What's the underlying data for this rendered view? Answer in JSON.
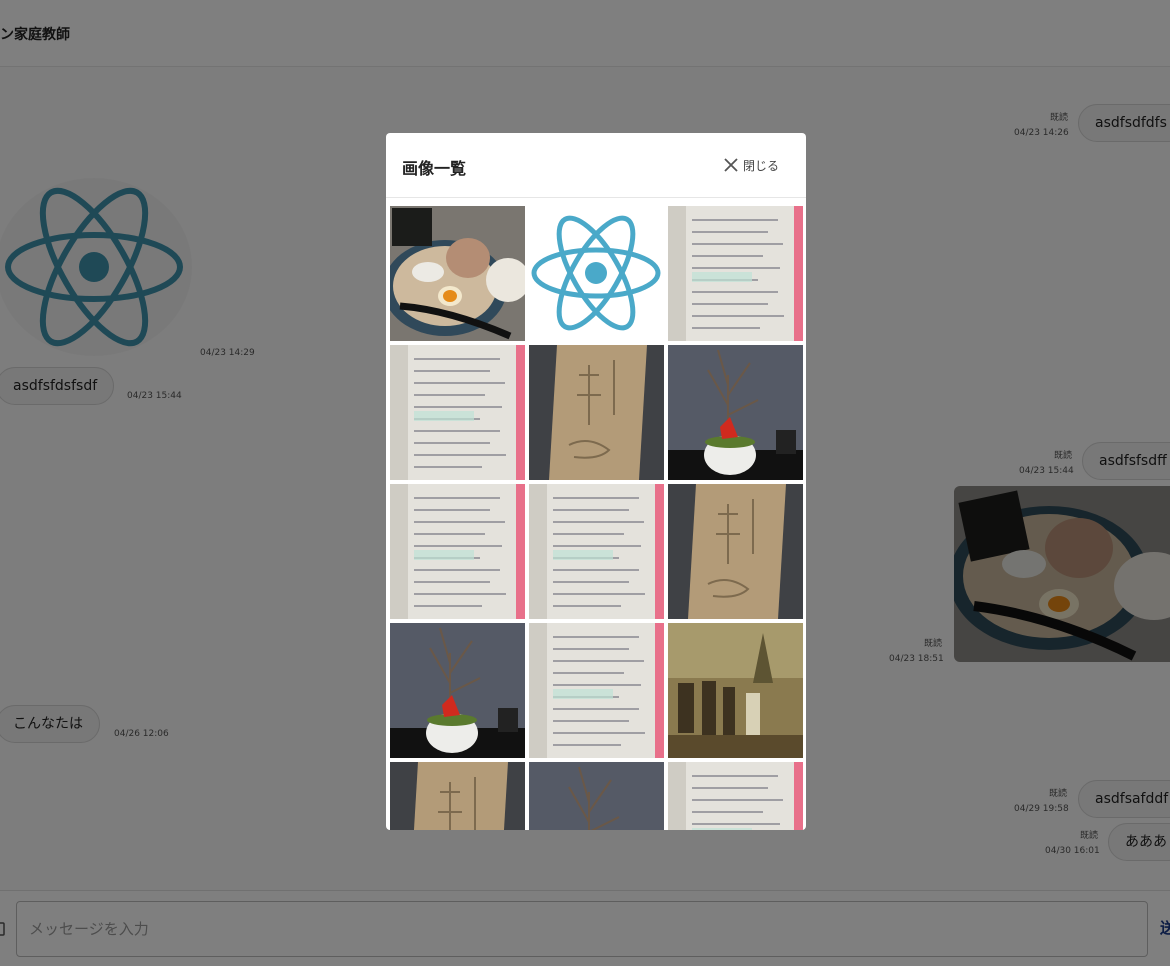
{
  "header": {
    "title": "ン家庭教師"
  },
  "messages": {
    "m1": {
      "read": "既読",
      "time": "04/23 14:26",
      "text": "asdfsdfdfs"
    },
    "m2": {
      "time": "04/23 14:29",
      "image": "react-logo"
    },
    "m3": {
      "time": "04/23 15:44",
      "text": "asdfsfdsfsdf"
    },
    "m4": {
      "read": "既読",
      "time": "04/23 15:44",
      "text": "asdfsfsdff"
    },
    "m5": {
      "read": "既読",
      "time": "04/23 18:51",
      "image": "ramen-photo"
    },
    "m6": {
      "time": "04/26 12:06",
      "text": "こんなたは"
    },
    "m7": {
      "read": "既読",
      "time": "04/29 19:58",
      "text": "asdfsafddf"
    },
    "m8": {
      "read": "既読",
      "time": "04/30 16:01",
      "text": "あああ"
    }
  },
  "composer": {
    "placeholder": "メッセージを入力",
    "send_label": "送"
  },
  "modal": {
    "title": "画像一覧",
    "close_label": "閉じる",
    "images": [
      "ramen",
      "react-logo",
      "math-notebook",
      "math-notebook",
      "stone-relief",
      "bonsai-tree",
      "math-notebook",
      "math-notebook",
      "stone-relief",
      "bonsai-tree",
      "math-notebook",
      "historical-painting",
      "stone-relief",
      "bonsai-tree",
      "math-notebook"
    ]
  },
  "colors": {
    "react": "#4aa9c9",
    "send": "#1a3a8a",
    "overlay": "rgba(0,0,0,0.5)"
  }
}
